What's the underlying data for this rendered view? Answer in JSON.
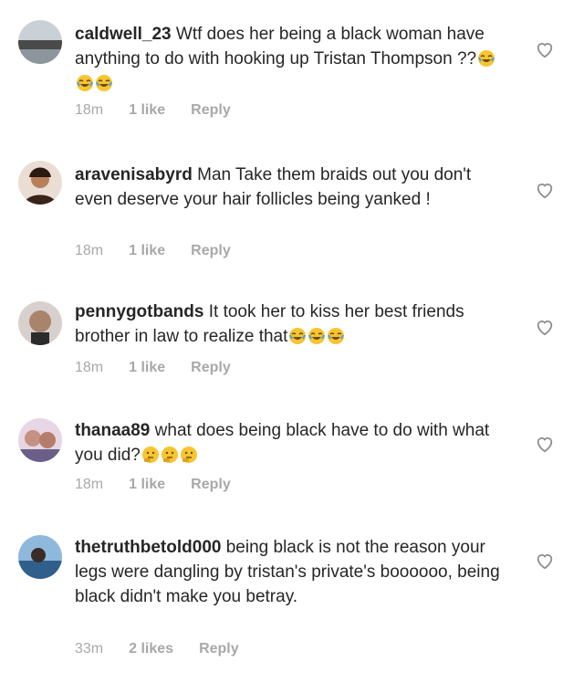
{
  "comments": [
    {
      "username": "caldwell_23",
      "text": "Wtf does her being a black woman have anything to do with hooking up Tristan Thompson ??",
      "emojis": [
        "joy",
        "joy",
        "joy"
      ],
      "time": "18m",
      "likes": "1 like",
      "reply": "Reply",
      "avatar_colors": [
        "#5a5a5a",
        "#b7c3cc"
      ]
    },
    {
      "username": "aravenisabyrd",
      "text": "Man Take them braids out you don't even deserve your hair follicles being yanked !",
      "emojis": [],
      "time": "18m",
      "likes": "1 like",
      "reply": "Reply",
      "avatar_colors": [
        "#3a2418",
        "#d9a27b"
      ]
    },
    {
      "username": "pennygotbands",
      "text": "It took her to kiss her best friends brother in law to realize that",
      "emojis": [
        "joy",
        "joy",
        "joy"
      ],
      "time": "18m",
      "likes": "1 like",
      "reply": "Reply",
      "avatar_colors": [
        "#2b2b2b",
        "#c49a7d"
      ]
    },
    {
      "username": "thanaa89",
      "text": "what does being black have to do with what you did?",
      "emojis": [
        "thinking",
        "thinking",
        "thinking"
      ],
      "time": "18m",
      "likes": "1 like",
      "reply": "Reply",
      "avatar_colors": [
        "#6b5f8a",
        "#e6b6c0"
      ]
    },
    {
      "username": "thetruthbetold000",
      "text": "being black is not the reason your legs were dangling by tristan's private's boooooo, being black didn't make you betray.",
      "emojis": [],
      "time": "33m",
      "likes": "2 likes",
      "reply": "Reply",
      "avatar_colors": [
        "#3d6fa0",
        "#a6c9e6"
      ]
    }
  ],
  "icons": {
    "like": "heart-outline-icon",
    "joy": "face-with-tears-of-joy-icon",
    "thinking": "thinking-face-icon"
  }
}
